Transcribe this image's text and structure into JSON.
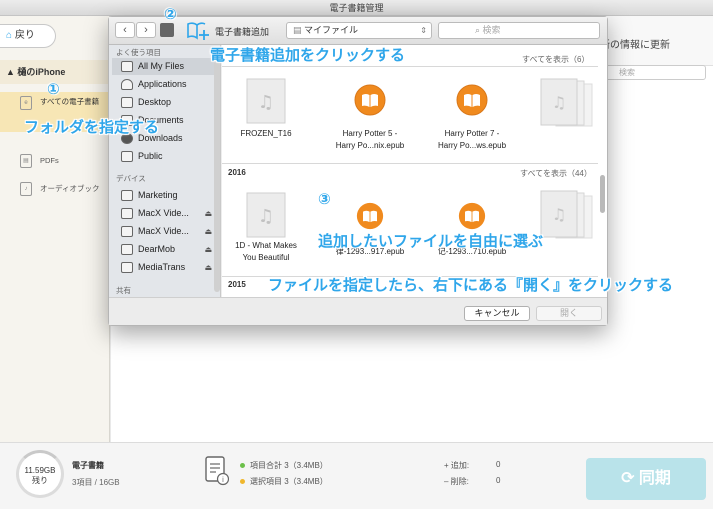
{
  "window": {
    "title": "電子書籍管理"
  },
  "sidebar": {
    "back_label": "戻り",
    "device": "樋のiPhone",
    "items": [
      {
        "label": "すべての電子書籍",
        "icon": "book-icon"
      },
      {
        "label": "PDFs",
        "icon": "pdf-icon"
      },
      {
        "label": "オーディオブック",
        "icon": "audiobook-icon"
      }
    ]
  },
  "main": {
    "update_label": "新の情報に更新",
    "search_placeholder": "検索"
  },
  "dialog": {
    "add_ebook_label": "電子書籍追加",
    "folder": "マイファイル",
    "search_placeholder": "検索",
    "sidebar": {
      "favorites_header": "よく使う項目",
      "favorites": [
        "All My Files",
        "Applications",
        "Desktop",
        "Documents",
        "Downloads",
        "Public"
      ],
      "devices_header": "デバイス",
      "devices": [
        "Marketing",
        "MacX Vide...",
        "MacX Vide...",
        "DearMob",
        "MediaTrans"
      ],
      "shared_header": "共有"
    },
    "sections": [
      {
        "year": "",
        "show_all": "すべてを表示（6）",
        "files": [
          {
            "name_1": "FROZEN_T16",
            "name_2": "",
            "type": "music"
          },
          {
            "name_1": "Harry Potter 5 -",
            "name_2": "Harry Po...nix.epub",
            "type": "ibook"
          },
          {
            "name_1": "Harry Potter 7 -",
            "name_2": "Harry Po...ws.epub",
            "type": "ibook"
          }
        ]
      },
      {
        "year": "2016",
        "show_all": "すべてを表示（44）",
        "files": [
          {
            "name_1": "1D - What Makes",
            "name_2": "You Beautiful",
            "type": "music"
          },
          {
            "name_1": "",
            "name_2": "律-1293...917.epub",
            "type": "ibook"
          },
          {
            "name_1": "",
            "name_2": "记-1293...710.epub",
            "type": "ibook"
          }
        ]
      },
      {
        "year": "2015"
      }
    ],
    "cancel_label": "キャンセル",
    "open_label": "開く"
  },
  "bottom": {
    "storage_used": "11.59GB",
    "storage_sub": "残り",
    "category": "電子書籍",
    "count": "3項目 / 16GB",
    "total_label": "項目合計 3（3.4MB）",
    "selected_label": "選択項目 3（3.4MB）",
    "added_label": "追加:",
    "added_value": "0",
    "deleted_label": "削除:",
    "deleted_value": "0",
    "sync_label": "同期"
  },
  "annotations": {
    "n1": "①",
    "n2": "②",
    "n3": "③",
    "a1": "フォルダを指定する",
    "a2": "電子書籍追加をクリックする",
    "a3": "追加したいファイルを自由に選ぶ",
    "a4": "ファイルを指定したら、右下にある『開く』をクリックする"
  },
  "colors": {
    "accent": "#2fa6ea",
    "ibook": "#f08a1e",
    "sync": "#b9e3ea"
  }
}
